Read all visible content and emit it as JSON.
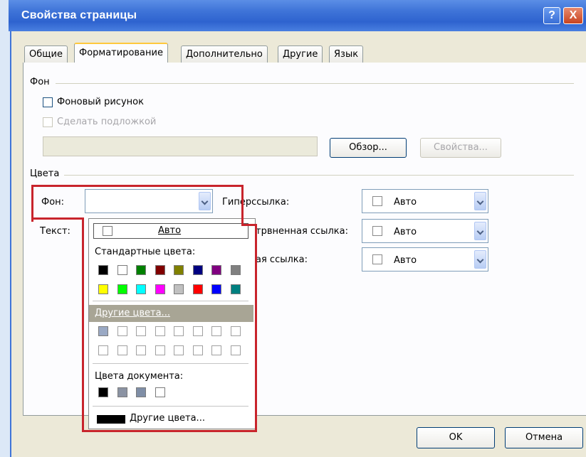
{
  "window": {
    "title": "Свойства страницы",
    "help_label": "?",
    "close_label": "X"
  },
  "tabs": [
    {
      "label": "Общие"
    },
    {
      "label": "Форматирование",
      "active": true
    },
    {
      "label": "Дополнительно"
    },
    {
      "label": "Другие"
    },
    {
      "label": "Язык"
    }
  ],
  "background_group": {
    "label": "Фон",
    "bg_image_checkbox": {
      "label": "Фоновый рисунок",
      "checked": false
    },
    "watermark_checkbox": {
      "label": "Сделать подложкой",
      "checked": false,
      "disabled": true
    },
    "path_value": "",
    "browse_label": "Обзор...",
    "properties_label": "Свойства..."
  },
  "colors_group": {
    "label": "Цвета",
    "bg_label": "Фон:",
    "text_label": "Текст:",
    "bg_value": "",
    "hyperlink_label": "Гиперссылка:",
    "visited_link_label": "трвненная ссылка:",
    "active_link_label": "ая ссылка:",
    "hyperlink_value": "Авто",
    "visited_value": "Авто",
    "active_value": "Авто"
  },
  "color_dropdown": {
    "auto_label": "Авто",
    "standard_label": "Стандартные цвета:",
    "standard_row1": [
      "#000000",
      "#ffffff",
      "#008000",
      "#800000",
      "#808000",
      "#000080",
      "#800080",
      "#808080"
    ],
    "standard_row2": [
      "#ffff00",
      "#00ff00",
      "#00ffff",
      "#ff00ff",
      "#c0c0c0",
      "#ff0000",
      "#0000ff",
      "#008080"
    ],
    "more_colors_highlight": "Другие цвета...",
    "custom_row1": [
      "#9aa9c4",
      "",
      "",
      "",
      "",
      "",
      "",
      ""
    ],
    "custom_row2": [
      "",
      "",
      "",
      "",
      "",
      "",
      "",
      ""
    ],
    "document_label": "Цвета документа:",
    "document_colors": [
      "#000000",
      "#8b93a3",
      "#7f8ea6",
      "#ffffff"
    ],
    "more_colors_bottom": "Другие цвета..."
  },
  "footer": {
    "ok_label": "OK",
    "cancel_label": "Отмена"
  }
}
